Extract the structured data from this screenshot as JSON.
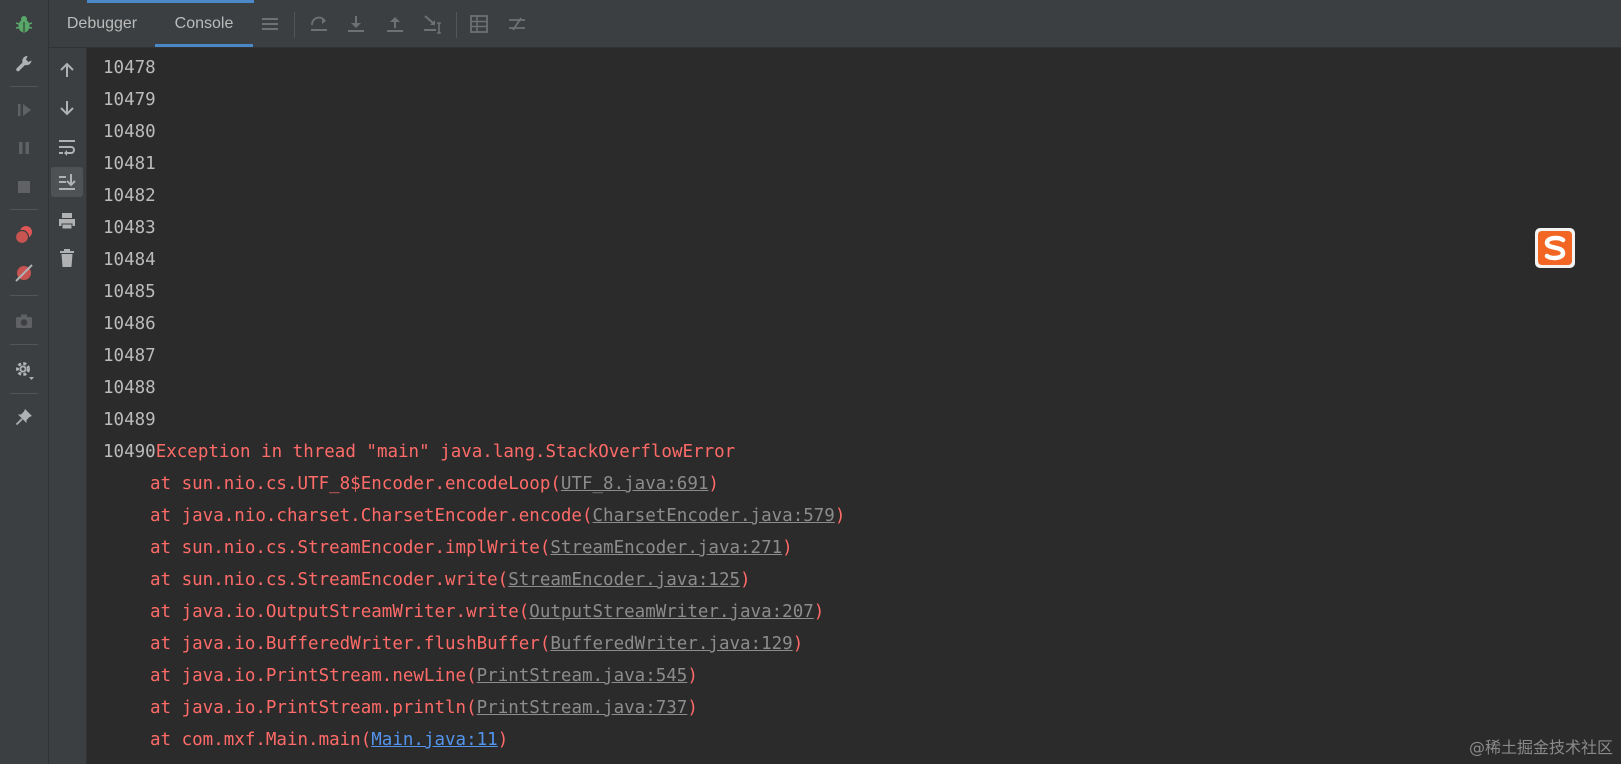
{
  "tabs": {
    "debugger": "Debugger",
    "console": "Console"
  },
  "left_toolbar_icons": [
    "bug-icon",
    "wrench-icon",
    "resume-icon",
    "pause-icon",
    "stop-icon",
    "view-breakpoints-icon",
    "mute-breakpoints-icon",
    "camera-icon",
    "settings-icon",
    "pin-icon"
  ],
  "header_icons": [
    "layout-menu-icon",
    "step-over-icon",
    "step-into-icon",
    "step-out-icon",
    "run-to-cursor-icon",
    "evaluate-expression-icon",
    "trace-icon"
  ],
  "console_toolbar_icons": [
    "up-arrow-icon",
    "down-arrow-icon",
    "soft-wrap-icon",
    "scroll-to-end-icon",
    "print-icon",
    "trash-icon"
  ],
  "colors": {
    "background": "#2b2b2b",
    "toolbar": "#3c3f41",
    "accent": "#4a88c7",
    "output_text": "#bbbbbb",
    "error_text": "#ff6b68",
    "link_text": "#8c8c8c",
    "user_link_text": "#5394ec"
  },
  "console": {
    "numbers": [
      "10478",
      "10479",
      "10480",
      "10481",
      "10482",
      "10483",
      "10484",
      "10485",
      "10486",
      "10487",
      "10488",
      "10489"
    ],
    "last_number": "10490",
    "exception": "Exception in thread \"main\" java.lang.StackOverflowError",
    "trace": [
      {
        "prefix": "at sun.nio.cs.UTF_8$Encoder.encodeLoop(",
        "link": "UTF_8.java:691",
        "suffix": ")"
      },
      {
        "prefix": "at java.nio.charset.CharsetEncoder.encode(",
        "link": "CharsetEncoder.java:579",
        "suffix": ")"
      },
      {
        "prefix": "at sun.nio.cs.StreamEncoder.implWrite(",
        "link": "StreamEncoder.java:271",
        "suffix": ")"
      },
      {
        "prefix": "at sun.nio.cs.StreamEncoder.write(",
        "link": "StreamEncoder.java:125",
        "suffix": ")"
      },
      {
        "prefix": "at java.io.OutputStreamWriter.write(",
        "link": "OutputStreamWriter.java:207",
        "suffix": ")"
      },
      {
        "prefix": "at java.io.BufferedWriter.flushBuffer(",
        "link": "BufferedWriter.java:129",
        "suffix": ")"
      },
      {
        "prefix": "at java.io.PrintStream.newLine(",
        "link": "PrintStream.java:545",
        "suffix": ")"
      },
      {
        "prefix": "at java.io.PrintStream.println(",
        "link": "PrintStream.java:737",
        "suffix": ")"
      },
      {
        "prefix": "at com.mxf.Main.main(",
        "link": "Main.java:11",
        "suffix": ")"
      }
    ]
  },
  "watermark": "@稀土掘金技术社区"
}
